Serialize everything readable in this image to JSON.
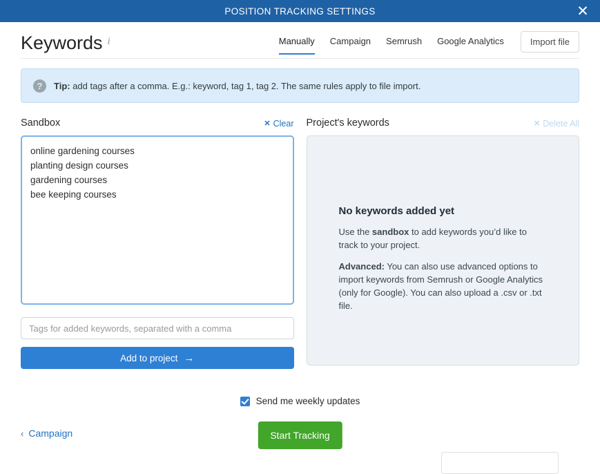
{
  "titlebar": {
    "title": "POSITION TRACKING SETTINGS",
    "close_label": "✕"
  },
  "header": {
    "page_title": "Keywords",
    "info_icon": "i",
    "tabs": [
      {
        "label": "Manually",
        "active": true
      },
      {
        "label": "Campaign",
        "active": false
      },
      {
        "label": "Semrush",
        "active": false
      },
      {
        "label": "Google Analytics",
        "active": false
      }
    ],
    "import_button": "Import file"
  },
  "tip": {
    "icon": "?",
    "label": "Tip:",
    "text": " add tags after a comma. E.g.: keyword, tag 1, tag 2. The same rules apply to file import."
  },
  "sandbox": {
    "title": "Sandbox",
    "clear_label": "Clear",
    "clear_icon": "✕",
    "value": "online gardening courses\nplanting design courses\ngardening courses\nbee keeping courses",
    "tags_placeholder": "Tags for added keywords, separated with a comma",
    "tags_value": "",
    "add_button": "Add to project",
    "add_button_arrow": "→"
  },
  "project_keywords": {
    "title": "Project's keywords",
    "delete_all_label": "Delete All",
    "delete_all_icon": "✕",
    "empty_title": "No keywords added yet",
    "empty_line1_pre": "Use the ",
    "empty_line1_bold": "sandbox",
    "empty_line1_post": " to add keywords you’d like to track to your project.",
    "empty_line2_bold": "Advanced:",
    "empty_line2_post": " You can also use advanced options to import keywords from Semrush or Google Analytics (only for Google). You can also upload a .csv or .txt file."
  },
  "footer": {
    "weekly_updates_label": "Send me weekly updates",
    "weekly_updates_checked": true,
    "back_label": "Campaign",
    "back_icon": "‹",
    "start_button": "Start Tracking"
  },
  "colors": {
    "titlebar": "#1f61a5",
    "accent_blue": "#2e80d4",
    "link_blue": "#2173c4",
    "start_green": "#41a62a",
    "tip_bg": "#dcecfa",
    "panel_bg": "#eef2f6"
  }
}
